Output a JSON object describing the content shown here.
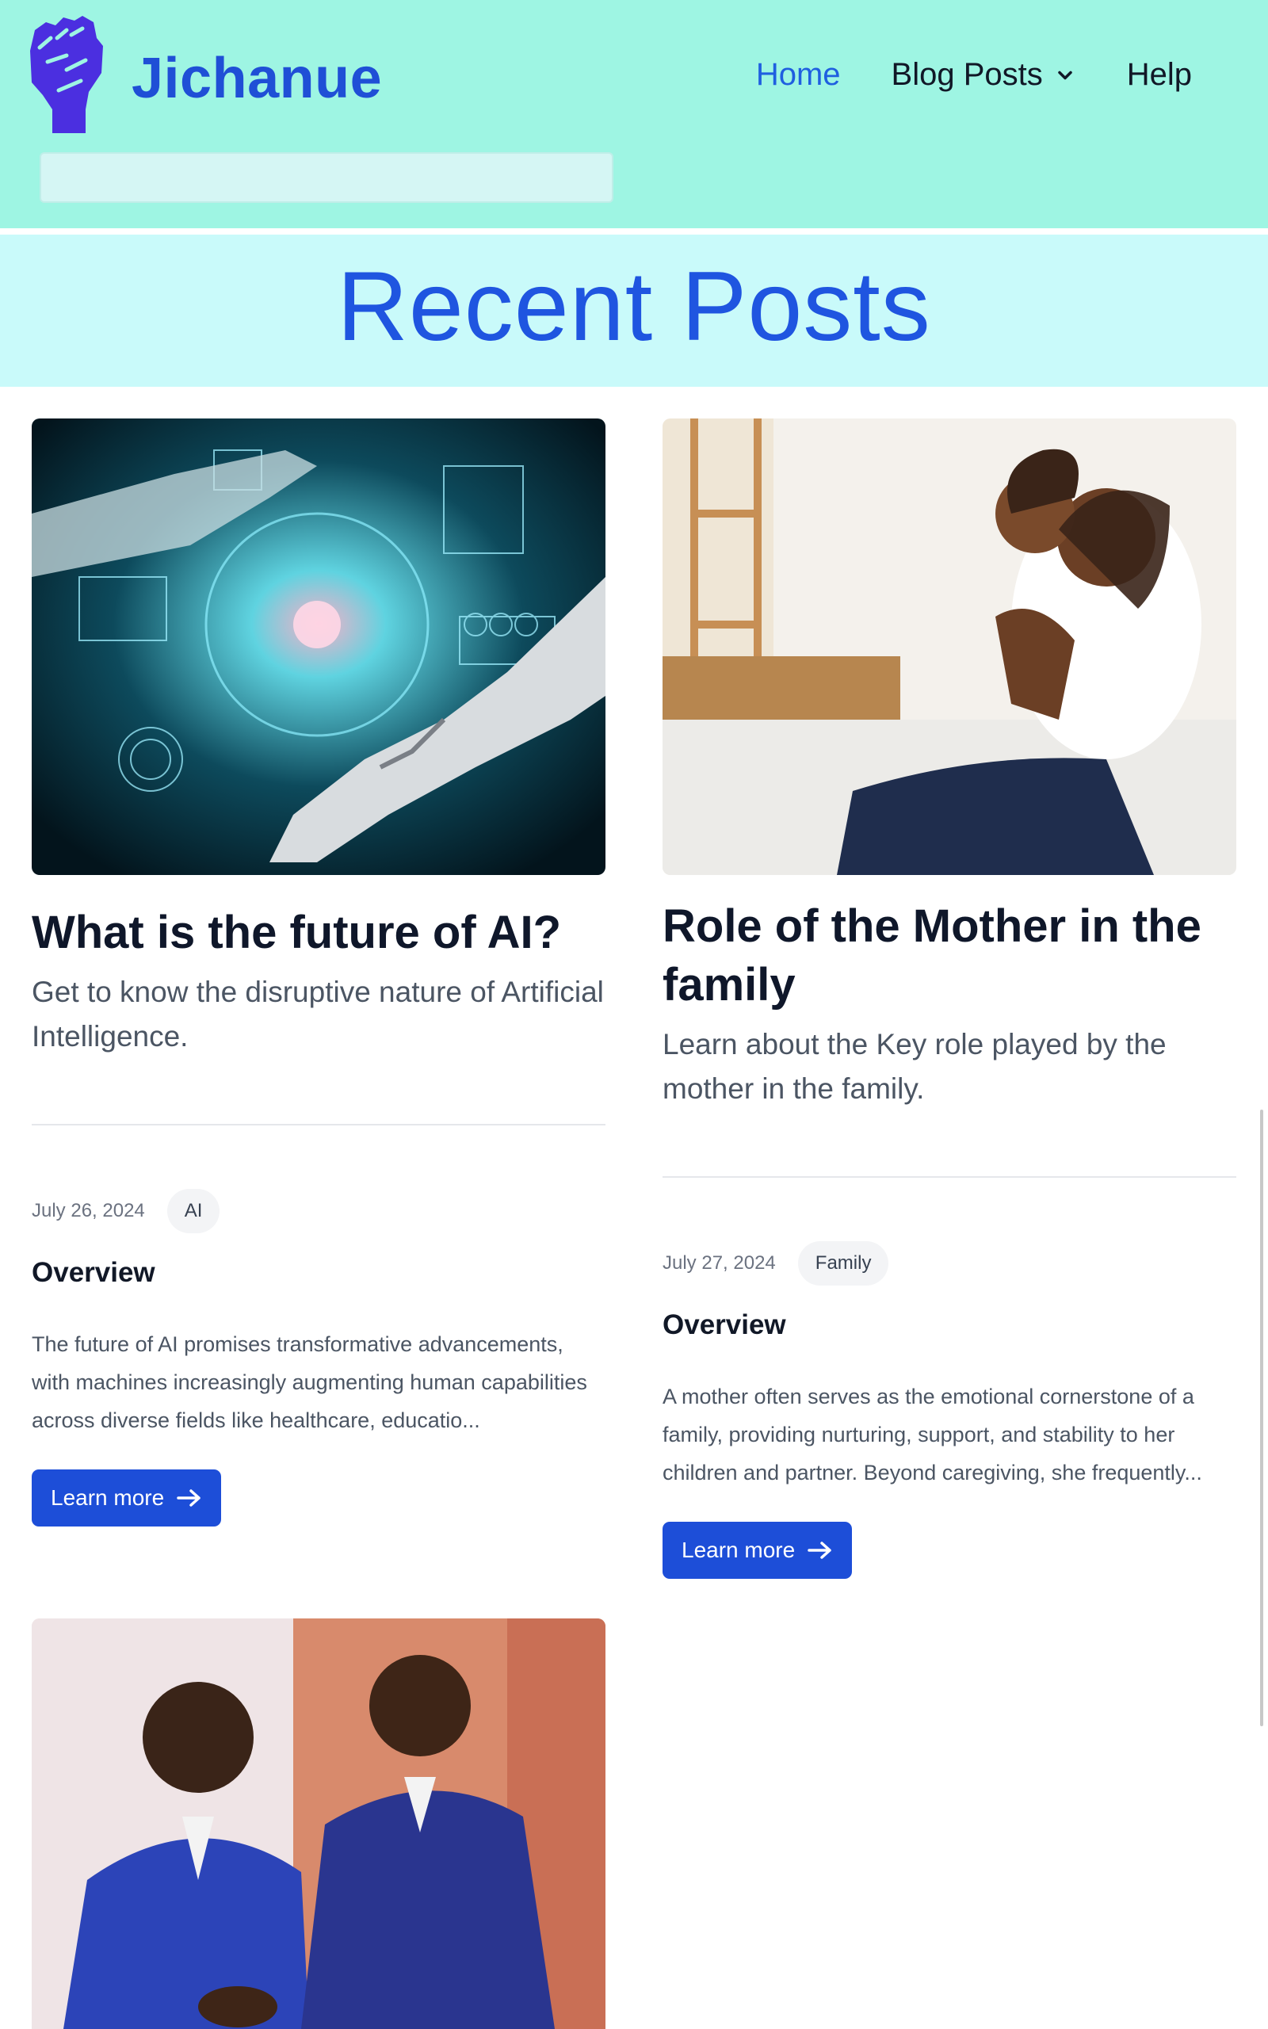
{
  "site": {
    "brand": "Jichanue",
    "logo_icon": "raised-fist-icon",
    "colors": {
      "header_bg": "#9ef5e3",
      "hero_bg": "#c9fafa",
      "accent": "#1f55e0",
      "button": "#1d4ed8"
    }
  },
  "nav": {
    "home": "Home",
    "blog_posts": "Blog Posts",
    "help": "Help"
  },
  "hero": {
    "title": "Recent Posts"
  },
  "posts": [
    {
      "image": "ai-robot-hand-image",
      "title": "What is the future of AI?",
      "subtitle": "Get to know the disruptive nature of Artificial Intelligence.",
      "date": "July 26, 2024",
      "category": "AI",
      "section": "Overview",
      "excerpt": "The future of AI promises transformative advancements, with machines increasingly augmenting human capabilities across diverse fields like healthcare, educatio...",
      "cta": "Learn more"
    },
    {
      "image": "mother-and-child-image",
      "title": "Role of the Mother in the family",
      "subtitle": "Learn about the Key role played by the mother in the family.",
      "date": "July 27, 2024",
      "category": "Family",
      "section": "Overview",
      "excerpt": "A mother often serves as the emotional cornerstone of a family, providing nurturing, support, and stability to her children and partner. Beyond caregiving, she frequently...",
      "cta": "Learn more"
    },
    {
      "image": "leaders-handshake-image"
    }
  ]
}
